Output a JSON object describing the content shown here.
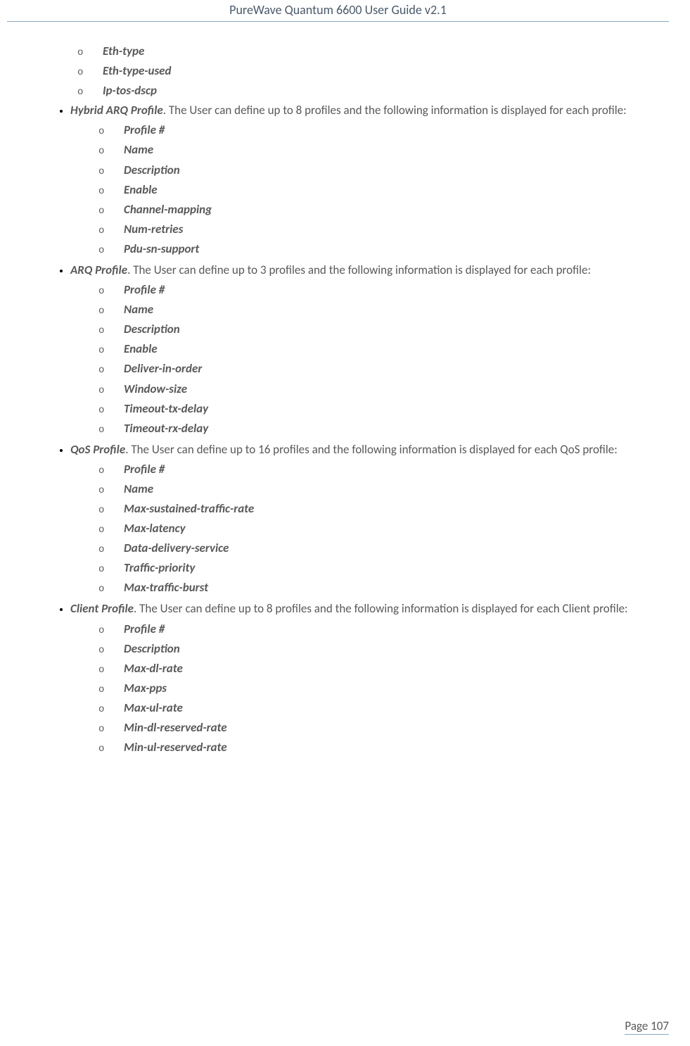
{
  "header": {
    "title": "PureWave Quantum 6600 User Guide v2.1"
  },
  "content": {
    "intro_items": [
      "Eth-type",
      "Eth-type-used",
      "Ip-tos-dscp"
    ],
    "sections": [
      {
        "title": "Hybrid ARQ Profile",
        "desc": ". The User can define up to 8 profiles and the following information is displayed for each profile:",
        "items": [
          "Profile #",
          "Name",
          "Description",
          "Enable",
          "Channel-mapping",
          "Num-retries",
          "Pdu-sn-support"
        ]
      },
      {
        "title": "ARQ Profile",
        "desc": ". The User can define up to 3 profiles and the following information is displayed for each profile:",
        "items": [
          "Profile #",
          "Name",
          "Description",
          "Enable",
          "Deliver-in-order",
          "Window-size",
          "Timeout-tx-delay",
          "Timeout-rx-delay"
        ]
      },
      {
        "title": "QoS Profile",
        "desc": ". The User can define up to 16 profiles and the following information is displayed for each QoS profile:",
        "items": [
          "Profile #",
          "Name",
          "Max-sustained-traffic-rate",
          "Max-latency",
          "Data-delivery-service",
          "Traffic-priority",
          "Max-traffic-burst"
        ]
      },
      {
        "title": "Client Profile",
        "desc": ". The User can define up to 8 profiles and the following information is displayed for each Client profile:",
        "items": [
          "Profile #",
          "Description",
          "Max-dl-rate",
          "Max-pps",
          "Max-ul-rate",
          "Min-dl-reserved-rate",
          "Min-ul-reserved-rate"
        ]
      }
    ]
  },
  "footer": {
    "page_label": "Page 107"
  }
}
